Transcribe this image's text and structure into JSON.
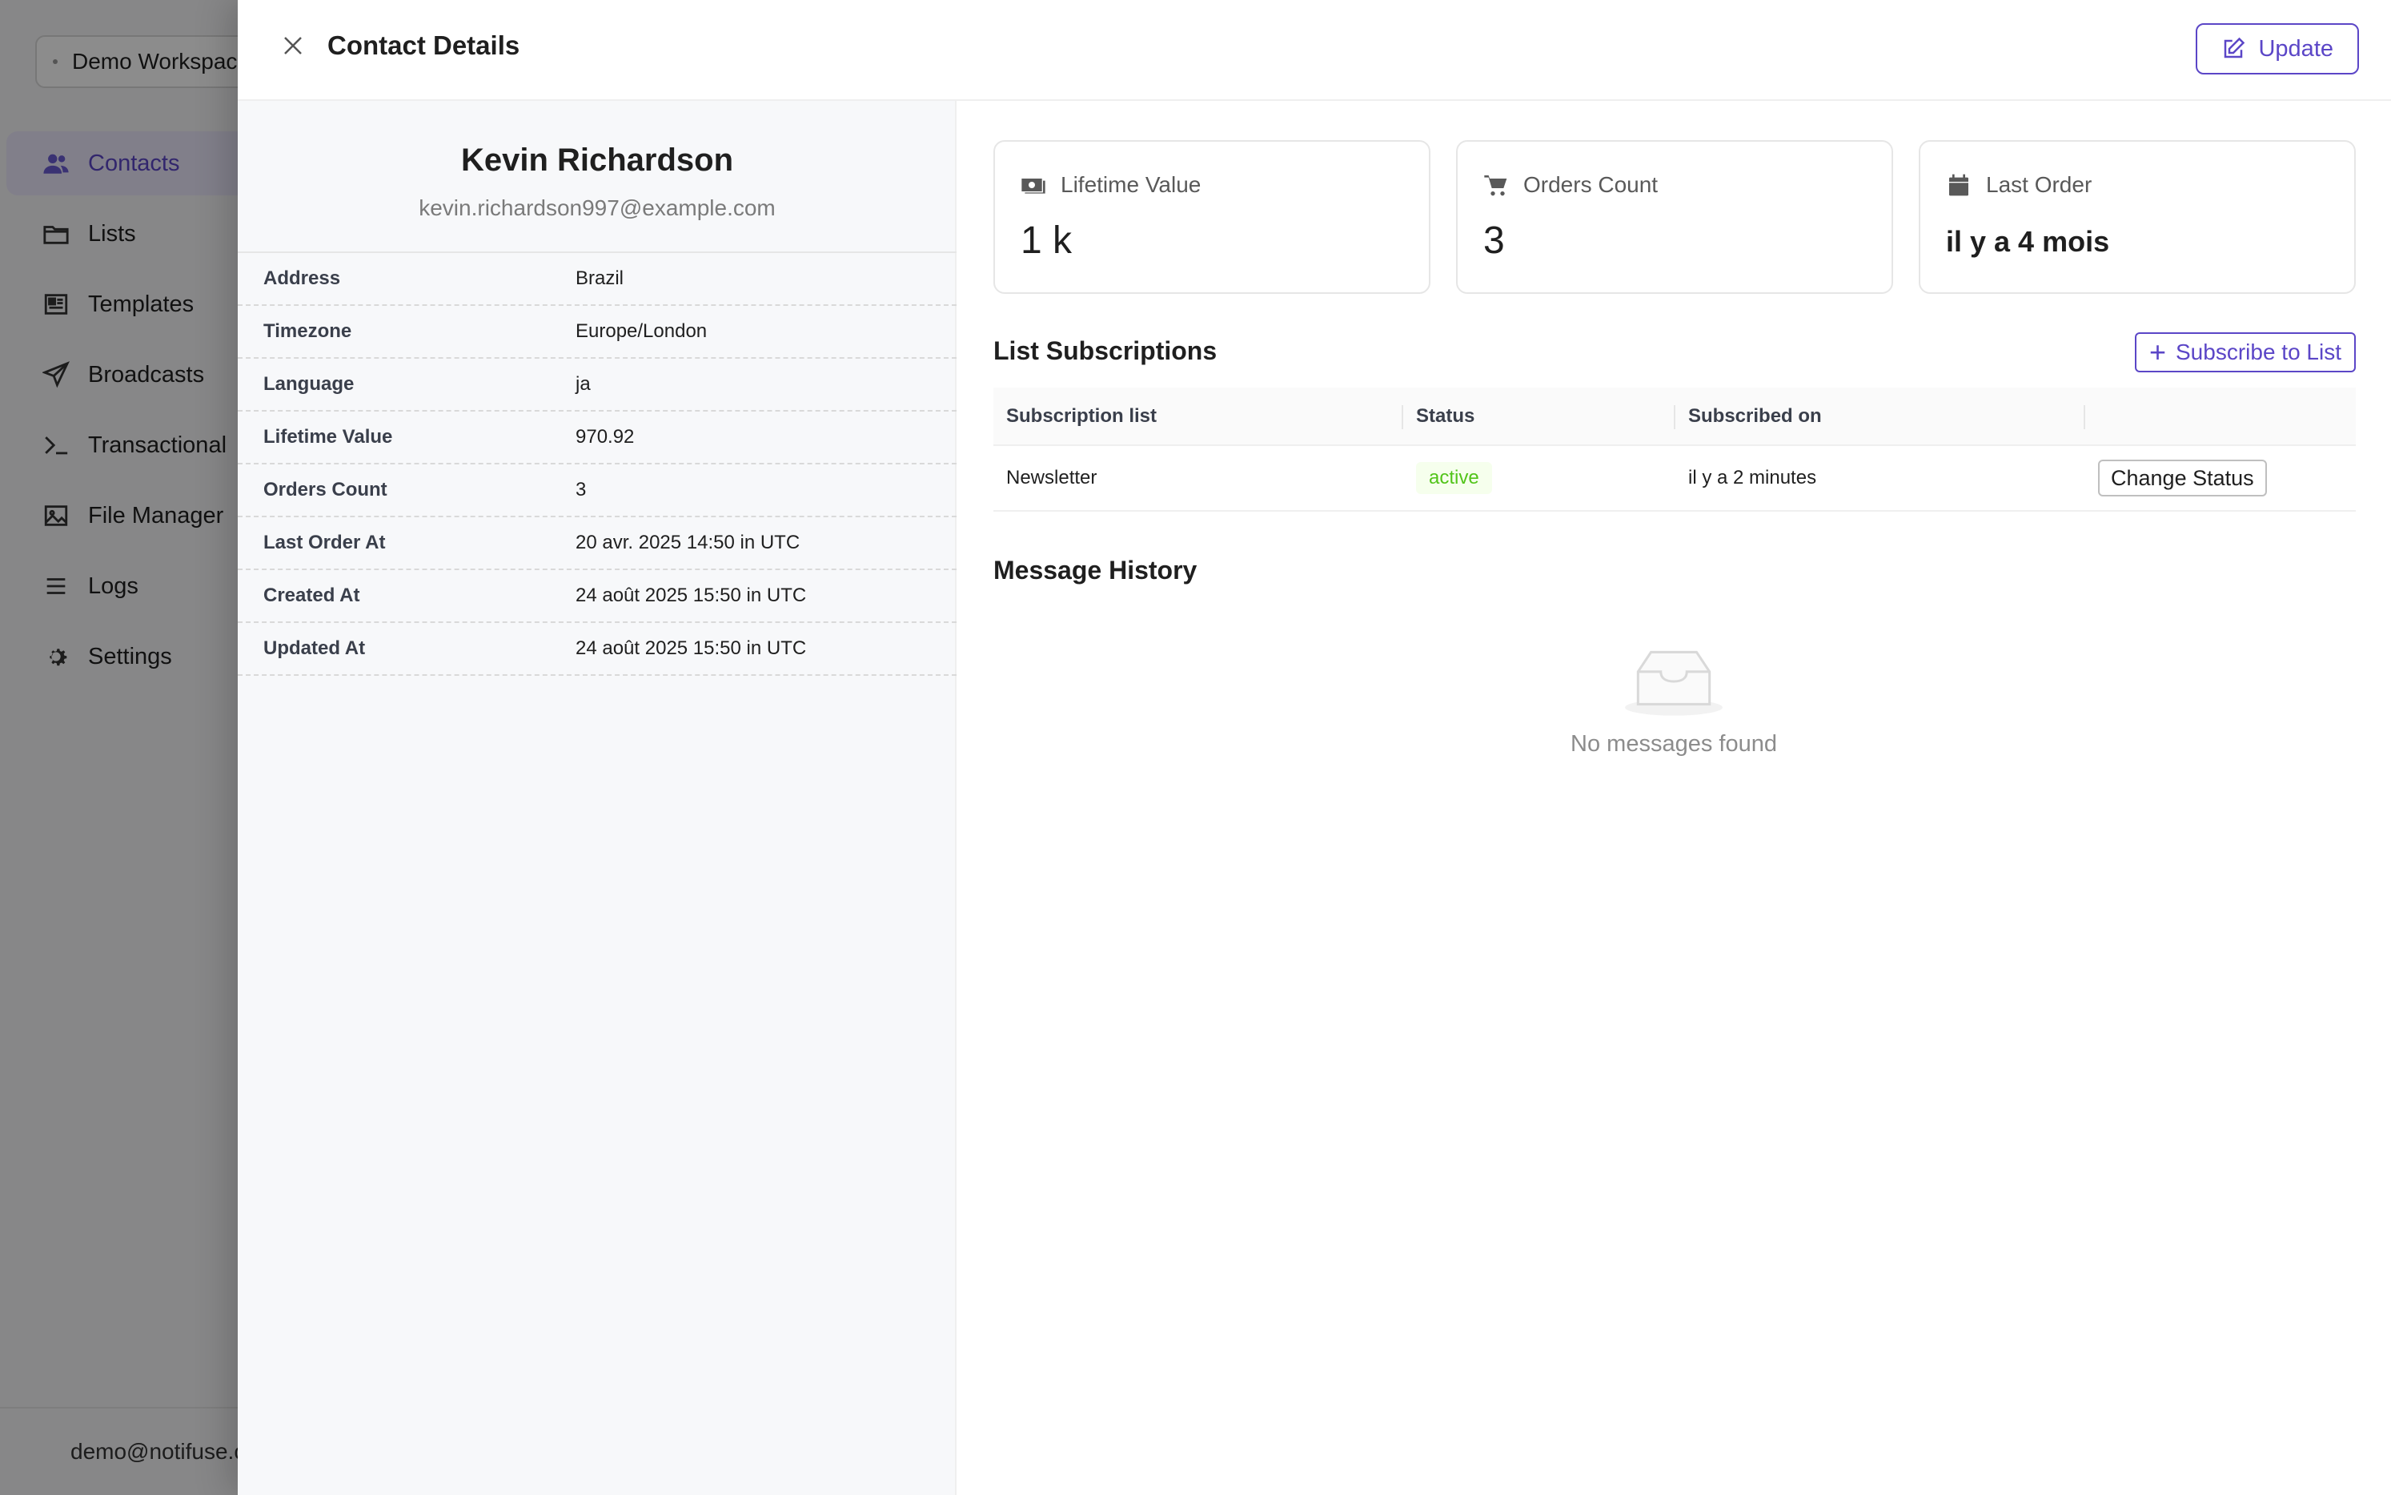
{
  "background_app": {
    "workspace": "Demo Workspace",
    "nav": [
      {
        "label": "Contacts",
        "icon": "users-icon",
        "active": true
      },
      {
        "label": "Lists",
        "icon": "folder-icon",
        "active": false
      },
      {
        "label": "Templates",
        "icon": "template-icon",
        "active": false
      },
      {
        "label": "Broadcasts",
        "icon": "send-icon",
        "active": false
      },
      {
        "label": "Transactional",
        "icon": "terminal-icon",
        "active": false
      },
      {
        "label": "File Manager",
        "icon": "image-icon",
        "active": false
      },
      {
        "label": "Logs",
        "icon": "list-icon",
        "active": false
      },
      {
        "label": "Settings",
        "icon": "gear-icon",
        "active": false
      }
    ],
    "user_email": "demo@notifuse.com"
  },
  "drawer": {
    "title": "Contact Details",
    "update_label": "Update"
  },
  "contact": {
    "name": "Kevin Richardson",
    "email": "kevin.richardson997@example.com",
    "details": [
      {
        "label": "Address",
        "value": "Brazil"
      },
      {
        "label": "Timezone",
        "value": "Europe/London"
      },
      {
        "label": "Language",
        "value": "ja"
      },
      {
        "label": "Lifetime Value",
        "value": "970.92"
      },
      {
        "label": "Orders Count",
        "value": "3"
      },
      {
        "label": "Last Order At",
        "value": "20 avr. 2025 14:50 in UTC"
      },
      {
        "label": "Created At",
        "value": "24 août 2025 15:50 in UTC"
      },
      {
        "label": "Updated At",
        "value": "24 août 2025 15:50 in UTC"
      }
    ]
  },
  "stats": [
    {
      "label": "Lifetime Value",
      "value": "1 k",
      "icon": "money-icon"
    },
    {
      "label": "Orders Count",
      "value": "3",
      "icon": "cart-icon"
    },
    {
      "label": "Last Order",
      "value": "il y a 4 mois",
      "icon": "calendar-icon"
    }
  ],
  "subscriptions": {
    "title": "List Subscriptions",
    "subscribe_label": "Subscribe to List",
    "columns": [
      "Subscription list",
      "Status",
      "Subscribed on",
      ""
    ],
    "rows": [
      {
        "list": "Newsletter",
        "status": "active",
        "subscribed_on": "il y a 2 minutes",
        "action": "Change Status"
      }
    ]
  },
  "message_history": {
    "title": "Message History",
    "empty_text": "No messages found"
  },
  "colors": {
    "accent": "#5b46c7",
    "status_active": "#52c41a"
  }
}
